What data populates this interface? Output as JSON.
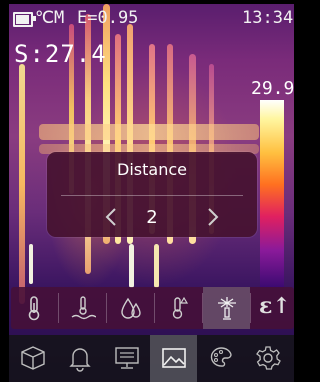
{
  "status_bar": {
    "battery_level": 0.8,
    "temperature_unit": "℃",
    "mode": "M",
    "emissivity": "E=0.95",
    "time": "13:34"
  },
  "spot_readout": "S:27.4",
  "color_scale": {
    "max_value": "29.9"
  },
  "dialog": {
    "title": "Distance",
    "value": "2",
    "prev_icon": "chevron-left-icon",
    "next_icon": "chevron-right-icon"
  },
  "measurement_toolbar": {
    "items": [
      {
        "icon": "thermometer-icon",
        "active": false
      },
      {
        "icon": "reflected-temperature-icon",
        "active": false
      },
      {
        "icon": "humidity-icon",
        "active": false
      },
      {
        "icon": "ambient-temperature-icon",
        "active": false
      },
      {
        "icon": "emissivity-icon",
        "active": true
      },
      {
        "icon": "distance-icon",
        "active": false
      }
    ],
    "distance_label": "ε↑"
  },
  "main_menu": {
    "items": [
      {
        "icon": "box-icon",
        "active": false
      },
      {
        "icon": "bell-icon",
        "active": false
      },
      {
        "icon": "monitor-icon",
        "active": false
      },
      {
        "icon": "image-icon",
        "active": true
      },
      {
        "icon": "palette-icon",
        "active": false
      },
      {
        "icon": "gear-icon",
        "active": false
      }
    ]
  }
}
